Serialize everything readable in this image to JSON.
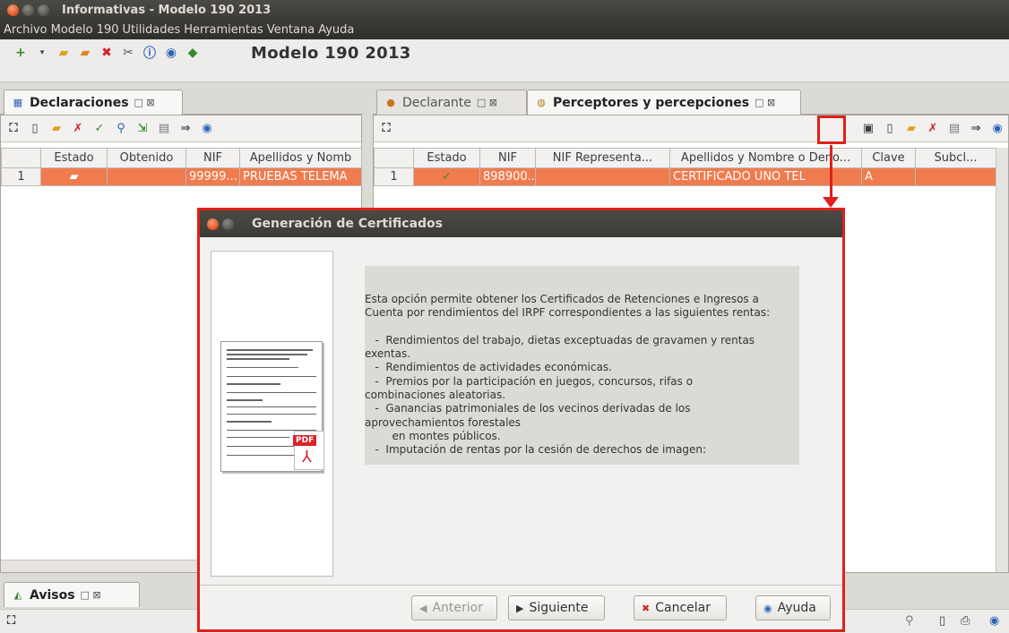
{
  "window": {
    "title": "Informativas - Modelo 190 2013"
  },
  "menu": {
    "items": [
      "Archivo",
      "Modelo 190",
      "Utilidades",
      "Herramientas",
      "Ventana",
      "Ayuda"
    ]
  },
  "toolbar": {
    "title": "Modelo 190 2013",
    "icons": [
      "add-icon",
      "dropdown-icon",
      "open-folder-icon",
      "open-folder-icon",
      "close-icon",
      "tools-icon",
      "info-icon",
      "help-icon",
      "module-icon"
    ]
  },
  "left_panel": {
    "tab_label": "Declaraciones",
    "columns": [
      "Estado",
      "Obtenido",
      "NIF",
      "Apellidos y Nomb"
    ],
    "rows": [
      {
        "num": "1",
        "estado": "folder",
        "obtenido": "",
        "nif": "99999...",
        "nombre": "PRUEBAS TELEMA"
      }
    ]
  },
  "right_panel": {
    "tabs": [
      {
        "label": "Declarante",
        "active": false
      },
      {
        "label": "Perceptores y percepciones",
        "active": true
      }
    ],
    "columns": [
      "Estado",
      "NIF",
      "NIF Representa...",
      "Apellidos y Nombre o Deno...",
      "Clave",
      "Subcl..."
    ],
    "rows": [
      {
        "num": "1",
        "estado": "✓",
        "nif": "898900...",
        "nif_rep": "",
        "nombre": "CERTIFICADO UNO TEL",
        "clave": "A",
        "subclave": ""
      }
    ]
  },
  "bottom": {
    "tab_label": "Avisos"
  },
  "dialog": {
    "title": "Generación de Certificados",
    "description": "Esta opción permite obtener los Certificados de Retenciones e Ingresos a\nCuenta por rendimientos del IRPF correspondientes a las siguientes rentas:\n\n   -  Rendimientos del trabajo, dietas exceptuadas de gravamen y rentas\nexentas.\n   -  Rendimientos de actividades económicas.\n   -  Premios por la participación en juegos, concursos, rifas o\ncombinaciones aleatorias.\n   -  Ganancias patrimoniales de los vecinos derivadas de los\naprovechamientos forestales\n        en montes públicos.\n   -  Imputación de rentas por la cesión de derechos de imagen:",
    "buttons": {
      "previous": "Anterior",
      "next": "Siguiente",
      "cancel": "Cancelar",
      "help": "Ayuda"
    }
  },
  "colors": {
    "selection": "#f07b4f",
    "highlight": "#e0201a",
    "titlebar": "#3c3b37"
  }
}
